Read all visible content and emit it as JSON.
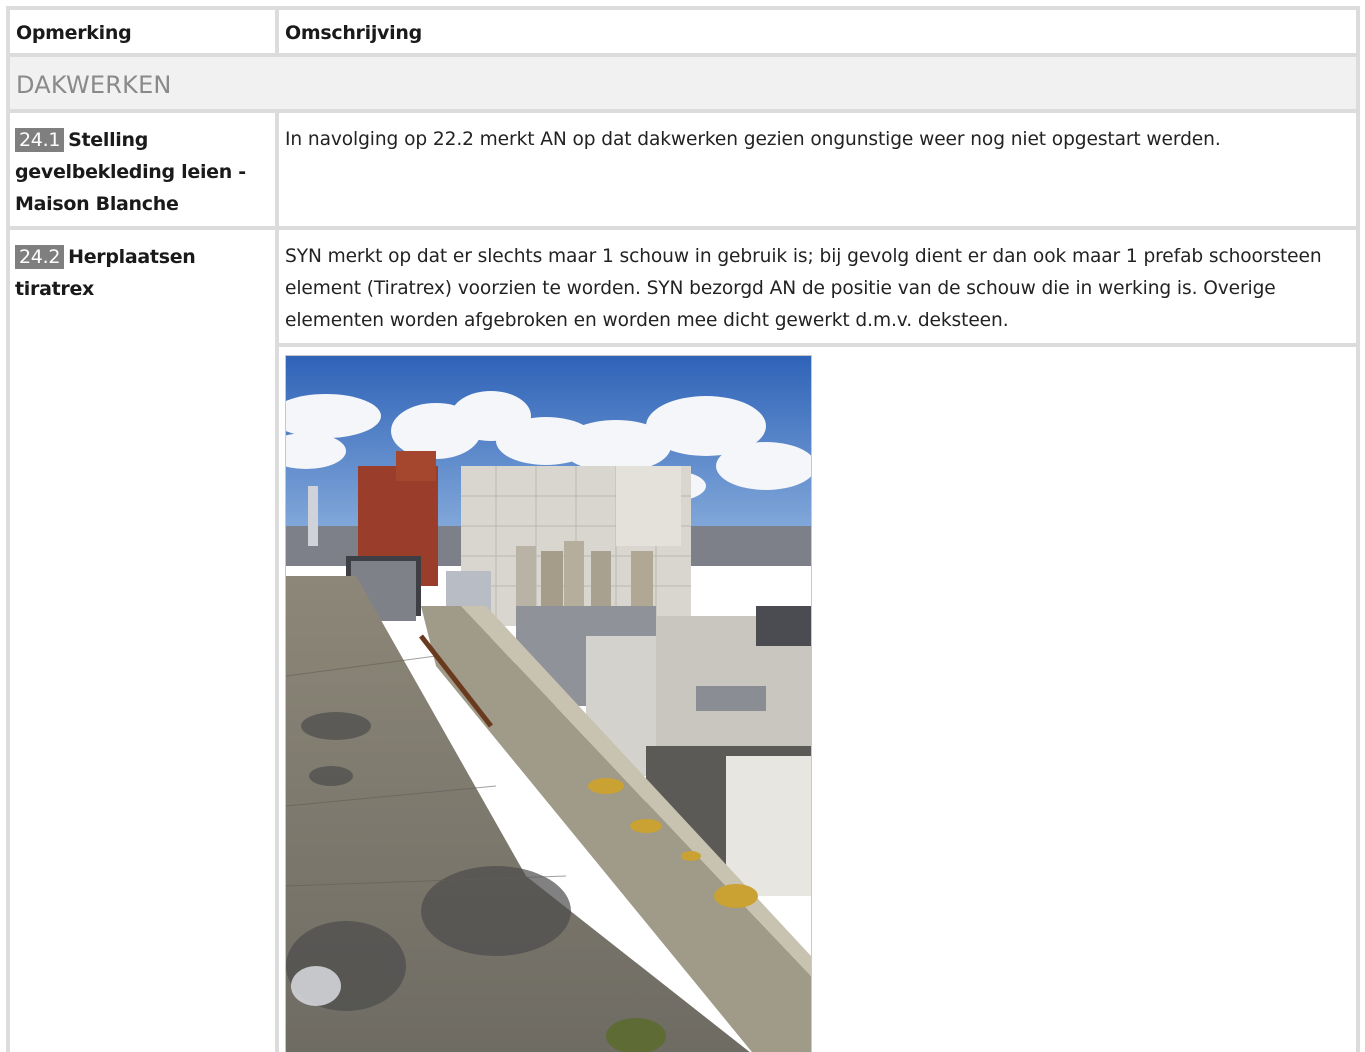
{
  "table": {
    "headers": {
      "remark": "Opmerking",
      "description": "Omschrijving"
    },
    "section_title": "DAKWERKEN",
    "items": [
      {
        "number": "24.1",
        "title": "Stelling gevelbekleding leien - Maison Blanche",
        "description": "In navolging op 22.2 merkt AN op dat dakwerken gezien ongunstige weer nog niet opgestart werden."
      },
      {
        "number": "24.2",
        "title": "Herplaatsen tiratrex",
        "description": "SYN merkt op dat er slechts maar 1 schouw in gebruik is; bij gevolg dient er dan ook maar 1 prefab schoorsteen element (Tiratrex) voorzien te worden. SYN bezorgd AN de positie van de schouw die in werking is. Overige elementen worden afgebroken en worden mee dicht gewerkt d.m.v. deksteen."
      }
    ]
  },
  "colors": {
    "grid": "#dcdcdc",
    "section_bg": "#f1f1f1",
    "section_text": "#8a8a8a",
    "number_badge": "#7f7f7f"
  }
}
